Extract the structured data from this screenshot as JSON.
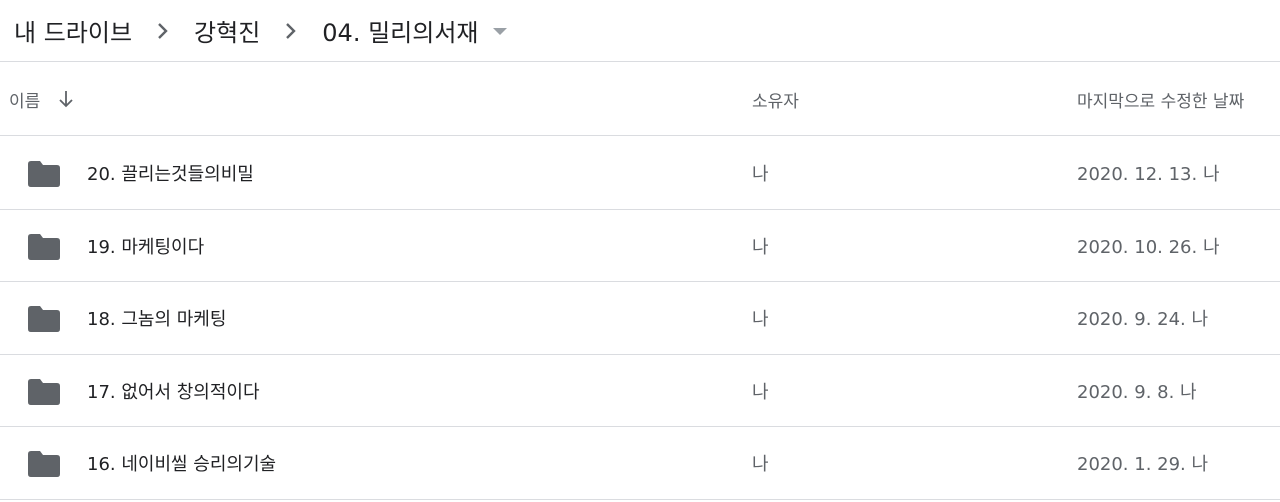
{
  "breadcrumb": {
    "items": [
      "내 드라이브",
      "강혁진"
    ],
    "current": "04. 밀리의서재"
  },
  "columns": {
    "name": "이름",
    "owner": "소유자",
    "modified": "마지막으로 수정한 날짜"
  },
  "rows": [
    {
      "name": "20. 끌리는것들의비밀",
      "owner": "나",
      "modified": "2020. 12. 13. 나"
    },
    {
      "name": "19. 마케팅이다",
      "owner": "나",
      "modified": "2020. 10. 26. 나"
    },
    {
      "name": "18. 그놈의 마케팅",
      "owner": "나",
      "modified": "2020. 9. 24. 나"
    },
    {
      "name": "17. 없어서 창의적이다",
      "owner": "나",
      "modified": "2020. 9. 8. 나"
    },
    {
      "name": "16. 네이비씰 승리의기술",
      "owner": "나",
      "modified": "2020. 1. 29. 나"
    }
  ],
  "icons": {
    "folder": "folder-icon",
    "separator": "chevron-right-icon",
    "dropdown": "caret-down-icon",
    "sort": "arrow-down-icon"
  },
  "colors": {
    "folder": "#5f6368",
    "text": "#202124",
    "muted": "#5f6368",
    "divider": "#dadce0"
  }
}
